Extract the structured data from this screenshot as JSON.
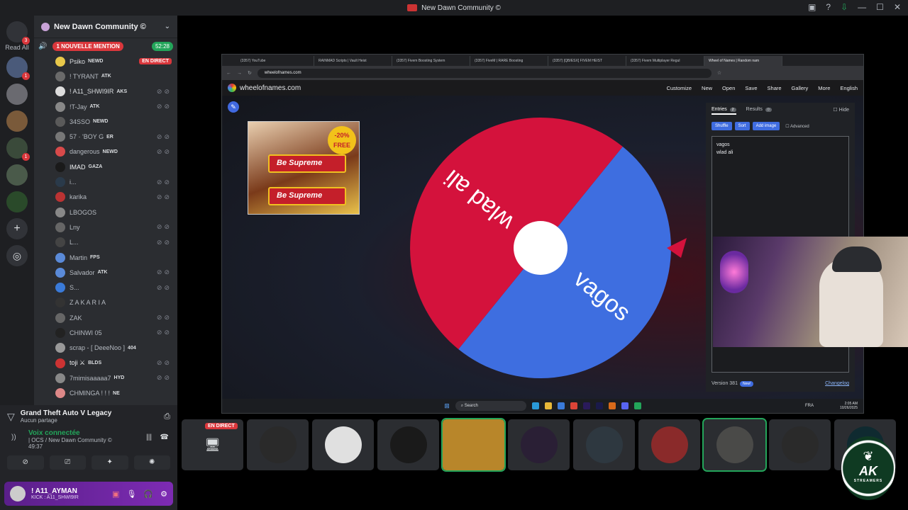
{
  "window": {
    "title": "New Dawn Community ©"
  },
  "rail": {
    "read_all": "Read All",
    "badge_top": "3",
    "badge_1": "1",
    "badge_2": "1"
  },
  "server": {
    "name": "New Dawn Community ©",
    "mention": "1 NOUVELLE MENTION",
    "timer": "52:28"
  },
  "voice_users": [
    {
      "name": "Psiko",
      "tag": "NEWD",
      "live": "EN DIRECT",
      "color": "#dbdee1"
    },
    {
      "name": "! TYRANT",
      "tag": "ATK",
      "color": "#b5bac1"
    },
    {
      "name": "! A11_SHWI9IR",
      "tag": "AKS",
      "color": "#dbdee1"
    },
    {
      "name": "!T-Jay",
      "tag": "ATK",
      "color": "#b5bac1"
    },
    {
      "name": "34SSO",
      "tag": "NEWD",
      "color": "#b5bac1"
    },
    {
      "name": "57 · 'BOY G",
      "tag": "ER",
      "color": "#b5bac1"
    },
    {
      "name": "dangerous",
      "tag": "NEWD",
      "color": "#b5bac1"
    },
    {
      "name": "IMAD",
      "tag": "GAZA",
      "color": "#f2f3f5"
    },
    {
      "name": "i...",
      "tag": "",
      "color": "#b5bac1"
    },
    {
      "name": "karika",
      "tag": "",
      "color": "#b5bac1"
    },
    {
      "name": "LBOGOS",
      "tag": "",
      "color": "#b5bac1"
    },
    {
      "name": "Lny",
      "tag": "",
      "color": "#b5bac1"
    },
    {
      "name": "L...",
      "tag": "",
      "color": "#b5bac1"
    },
    {
      "name": "Martin",
      "tag": "FPS",
      "color": "#b5bac1"
    },
    {
      "name": "Salvador",
      "tag": "ATK",
      "color": "#b5bac1"
    },
    {
      "name": "S...",
      "tag": "",
      "color": "#b5bac1"
    },
    {
      "name": "Z A K A R I A",
      "tag": "",
      "color": "#b5bac1"
    },
    {
      "name": "ZAK",
      "tag": "",
      "color": "#b5bac1"
    },
    {
      "name": "CHINWI 05",
      "tag": "",
      "color": "#b5bac1"
    },
    {
      "name": "scrap - [ DeeeNoo ]",
      "tag": "404",
      "color": "#b5bac1"
    },
    {
      "name": "toji ⚔",
      "tag": "BLDS",
      "color": "#f2f3f5"
    },
    {
      "name": "7mimisaaaaa7",
      "tag": "HYD",
      "color": "#b5bac1"
    },
    {
      "name": "CHMINGA ! ! !",
      "tag": "NE",
      "color": "#b5bac1"
    }
  ],
  "activity": {
    "game": "Grand Theft Auto V Legacy",
    "sharing": "Aucun partage",
    "voice_status": "Voix connectée",
    "voice_channel": "| OCS / New Dawn Community ©",
    "voice_time": "49:37"
  },
  "me": {
    "name": "! A11_AYMAN",
    "status": "KICK : A11_SHWI9IR"
  },
  "browser": {
    "tabs": [
      "(3357) YouTube",
      "RAINMAD Scripts | Vault Heist",
      "(3357) Fivem Boosting System",
      "(3357) FiveM | RARE Boosting",
      "(3357) [QB/ESX] FIVEM HEIST",
      "(3357) Fivem Multiplayer Regul",
      "Wheel of Names | Random nam"
    ],
    "url": "wheelofnames.com"
  },
  "won": {
    "site": "wheelofnames.com",
    "menu": [
      "Customize",
      "New",
      "Open",
      "Save",
      "Share",
      "Gallery",
      "More",
      "English"
    ],
    "tab_entries": "Entries",
    "entries_count": "2",
    "tab_results": "Results",
    "results_count": "0",
    "hide": "Hide",
    "btn_shuffle": "Shuffle",
    "btn_sort": "Sort",
    "btn_add_image": "Add image",
    "advanced": "Advanced",
    "entries": [
      "vagos",
      "wlad ali"
    ],
    "version": "Version 381",
    "new_badge": "New!",
    "changelog": "Changelog"
  },
  "wheel": {
    "slices": [
      {
        "label": "vagos",
        "color": "#3e6ee0"
      },
      {
        "label": "wlad ali",
        "color": "#d4123c"
      }
    ],
    "pointer_color": "#d4123c"
  },
  "ad": {
    "pct": "-20% FREE",
    "product": "Be Supreme"
  },
  "taskbar": {
    "search": "Search",
    "lang": "FRA",
    "time": "2:05 AM",
    "date": "10/26/2025"
  },
  "stream_tiles": {
    "live_label": "EN DIRECT",
    "tile_colors": [
      "#3a3c40",
      "#2a2a2a",
      "#e0e0e0",
      "#1a1a1a",
      "#b8862a",
      "#2a1f35",
      "#2e3840",
      "#8a2a2a",
      "#4a4a48",
      "#2a2a2a",
      "#0f2a30"
    ]
  },
  "ak": {
    "brand": "AK",
    "sub": "STREAMERS"
  }
}
